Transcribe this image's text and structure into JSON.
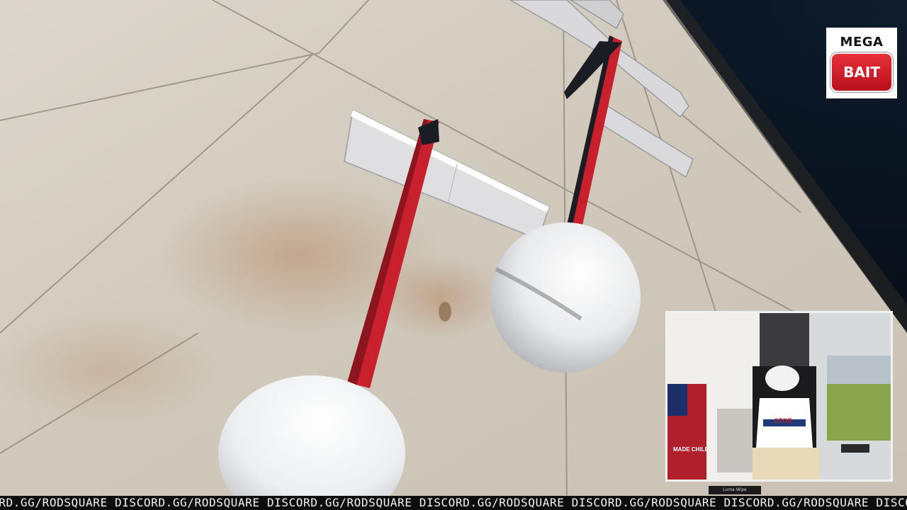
{
  "logo": {
    "line1": "MEGA",
    "line2": "BAIT",
    "badge_color": "#d41f2b"
  },
  "webcam": {
    "caption": "Luma Wipe",
    "jersey_text": "OTOR",
    "sign_text": "MADE CHILE"
  },
  "ticker": {
    "text": "ORD.GG/RODSQUARE DISCORD.GG/RODSQUARE DISCORD.GG/RODSQUARE DISCORD.GG/RODSQUARE DISCORD.GG/RODSQUARE DISCORD.GG/RODSQUARE DISCORD.GG/RODSQUARE DISCORD.GG/RODSQUARE"
  },
  "scene": {
    "space_color": "#07101c",
    "wall_color": "#d6d0c5",
    "hand_color": "#f2f2f2",
    "rod_color": "#c8202d"
  }
}
